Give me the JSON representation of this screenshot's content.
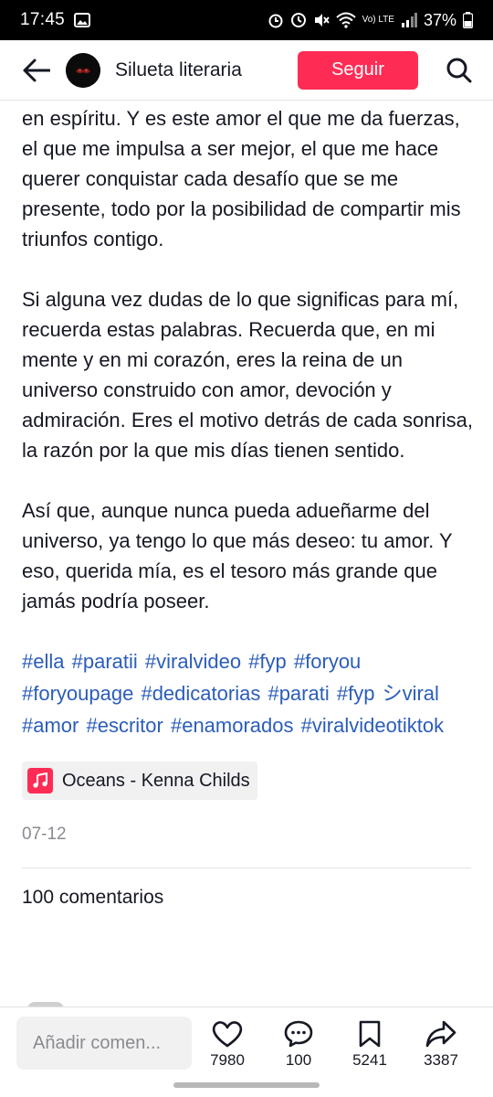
{
  "status_bar": {
    "time": "17:45",
    "battery": "37%",
    "network": "Vo) LTE"
  },
  "header": {
    "author_name": "Silueta literaria",
    "follow_label": "Seguir"
  },
  "post": {
    "paragraphs": [
      "en espíritu. Y es este amor el que me da fuerzas, el que me impulsa a ser mejor, el que me hace querer conquistar cada desafío que se me presente, todo por la posibilidad de compartir mis triunfos contigo.",
      "Si alguna vez dudas de lo que significas para mí, recuerda estas palabras. Recuerda que, en mi mente y en mi corazón, eres la reina de un universo construido con amor, devoción y admiración. Eres el motivo detrás de cada sonrisa, la razón por la que mis días tienen sentido.",
      "Así que, aunque nunca pueda adueñarme del universo, ya tengo lo que más deseo: tu amor. Y eso, querida mía, es el tesoro más grande que jamás podría poseer."
    ],
    "hashtags": [
      "#ella",
      "#paratii",
      "#viralvideo",
      "#fyp",
      "#foryou",
      "#foryoupage",
      "#dedicatorias",
      "#parati",
      "#fyp",
      "シviral",
      "#amor",
      "#escritor",
      "#enamorados",
      "#viralvideotiktok"
    ],
    "music": "Oceans - Kenna Childs",
    "date": "07-12",
    "comments_heading": "100 comentarios"
  },
  "bottom_bar": {
    "comment_placeholder": "Añadir comen...",
    "likes": "7980",
    "comments": "100",
    "saves": "5241",
    "shares": "3387"
  },
  "colors": {
    "accent": "#fe2c55",
    "hashtag": "#2b5db9",
    "text": "#161823",
    "muted": "#8a8b91"
  }
}
